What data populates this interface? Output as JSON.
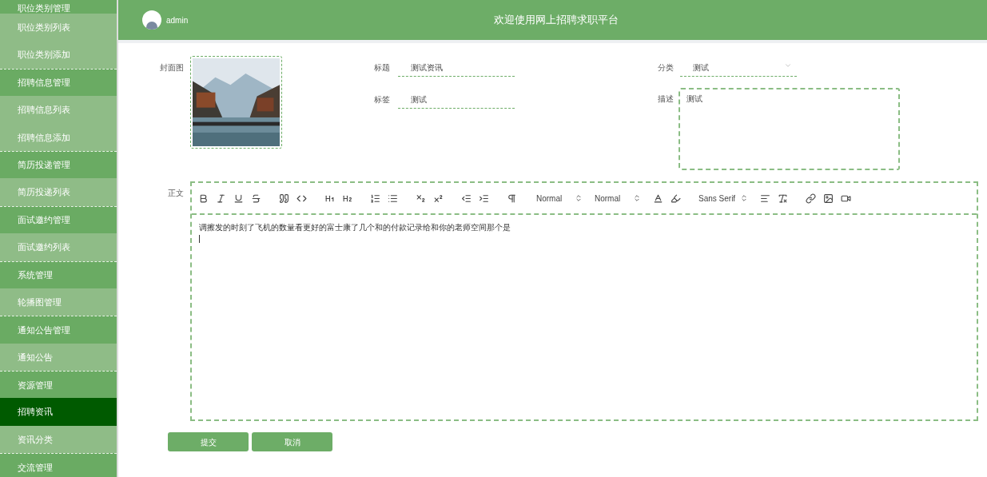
{
  "sidebar": {
    "items": [
      {
        "label": "职位类别管理",
        "kind": "group",
        "selected": false
      },
      {
        "label": "职位类别列表",
        "kind": "child",
        "selected": false
      },
      {
        "label": "职位类别添加",
        "kind": "child",
        "selected": false
      },
      {
        "label": "招聘信息管理",
        "kind": "group",
        "selected": false
      },
      {
        "label": "招聘信息列表",
        "kind": "child",
        "selected": false
      },
      {
        "label": "招聘信息添加",
        "kind": "child",
        "selected": false
      },
      {
        "label": "简历投递管理",
        "kind": "group",
        "selected": false
      },
      {
        "label": "简历投递列表",
        "kind": "child",
        "selected": false
      },
      {
        "label": "面试邀约管理",
        "kind": "group",
        "selected": false
      },
      {
        "label": "面试邀约列表",
        "kind": "child",
        "selected": false
      },
      {
        "label": "系统管理",
        "kind": "group",
        "selected": false
      },
      {
        "label": "轮播图管理",
        "kind": "child",
        "selected": false
      },
      {
        "label": "通知公告管理",
        "kind": "group",
        "selected": false
      },
      {
        "label": "通知公告",
        "kind": "child",
        "selected": false
      },
      {
        "label": "资源管理",
        "kind": "group",
        "selected": false
      },
      {
        "label": "招聘资讯",
        "kind": "child",
        "selected": true
      },
      {
        "label": "资讯分类",
        "kind": "child",
        "selected": false
      },
      {
        "label": "交流管理",
        "kind": "group",
        "selected": false
      }
    ]
  },
  "header": {
    "username": "admin",
    "title": "欢迎使用网上招聘求职平台"
  },
  "form": {
    "cover_label": "封面图",
    "title": {
      "label": "标题",
      "value": "测试资讯"
    },
    "tag": {
      "label": "标签",
      "value": "测试"
    },
    "category": {
      "label": "分类",
      "value": "测试"
    },
    "description": {
      "label": "描述",
      "value": "测试"
    },
    "body": {
      "label": "正文",
      "selects": [
        "Normal",
        "Normal",
        "Sans Serif"
      ],
      "content": "调擦发的时刻了飞机的数量看更好的富士康了几个和的付款记录给和你的老师空间那个是"
    }
  },
  "buttons": [
    "提交",
    "取消"
  ]
}
